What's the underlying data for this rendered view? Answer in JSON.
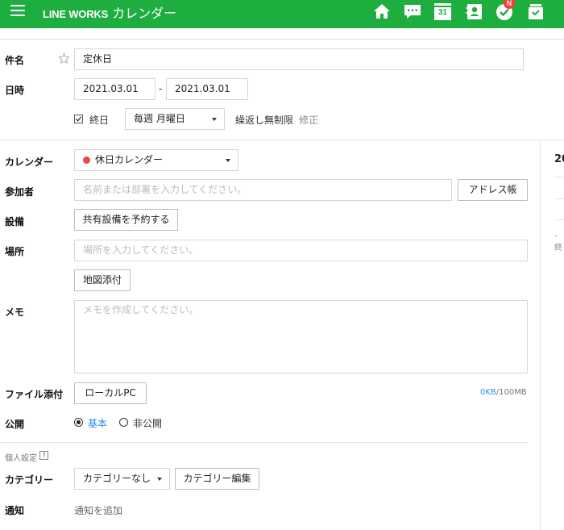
{
  "header": {
    "brand": "LINE WORKS",
    "app_name": "カレンダー",
    "calendar_day": "31",
    "badge": "N"
  },
  "form": {
    "subject_label": "件名",
    "subject_value": "定休日",
    "datetime_label": "日時",
    "start_date": "2021.03.01",
    "date_separator": "-",
    "end_date": "2021.03.01",
    "all_day_label": "終日",
    "repeat_value": "毎週 月曜日",
    "repeat_info": "繰返し無制限",
    "repeat_edit": "修正",
    "calendar_label": "カレンダー",
    "calendar_value": "休日カレンダー",
    "calendar_color": "#e8474c",
    "attendees_label": "参加者",
    "attendees_placeholder": "名前または部署を入力してください。",
    "address_book_button": "アドレス帳",
    "facility_label": "設備",
    "facility_button": "共有設備を予約する",
    "place_label": "場所",
    "place_placeholder": "場所を入力してください。",
    "map_button": "地図添付",
    "memo_label": "メモ",
    "memo_placeholder": "メモを作成してください。",
    "file_label": "ファイル添付",
    "local_pc_button": "ローカルPC",
    "file_used": "0KB",
    "file_total": "/100MB",
    "visibility_label": "公開",
    "visibility_public": "基本",
    "visibility_private": "非公開",
    "personal_settings": "個人設定",
    "help_mark": "?",
    "category_label": "カテゴリー",
    "category_value": "カテゴリーなし",
    "category_edit_button": "カテゴリー編集",
    "notify_label": "通知",
    "notify_add": "通知を追加"
  },
  "side_panel": {
    "heading_partial": "20",
    "item_partial": "- 終"
  },
  "colors": {
    "header_green": "#1ead3f",
    "link_blue": "#2d8ef0"
  }
}
